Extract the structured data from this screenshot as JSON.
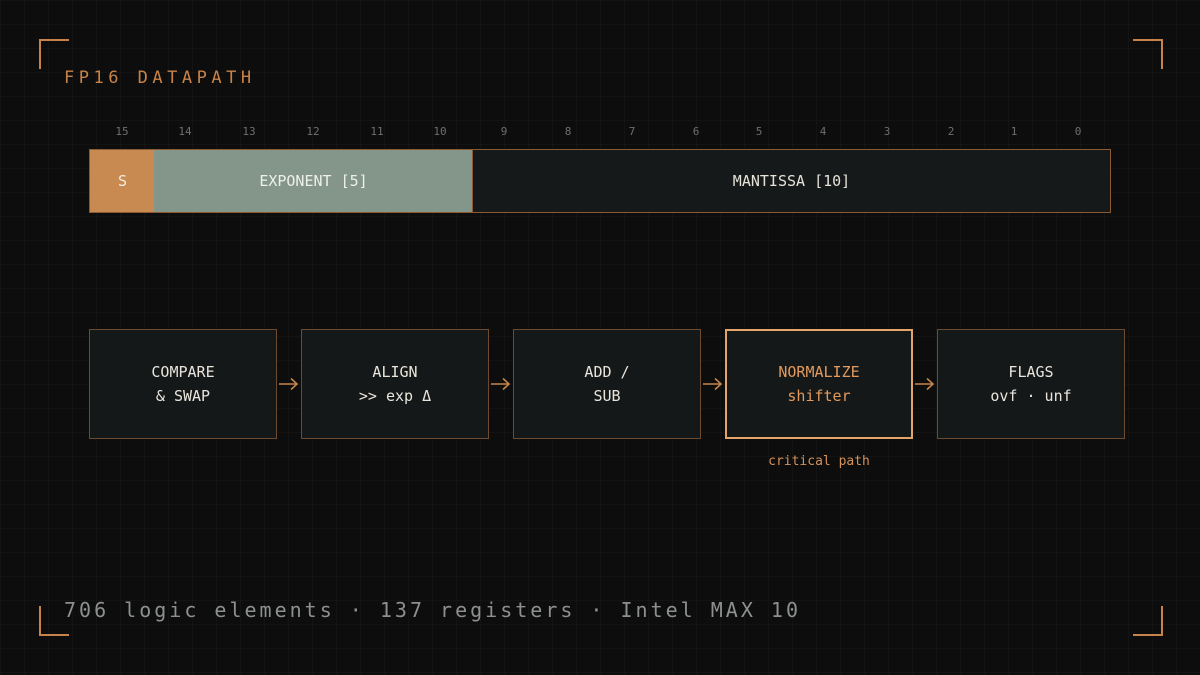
{
  "title": "FP16 DATAPATH",
  "bit_numbers": [
    "15",
    "14",
    "13",
    "12",
    "11",
    "10",
    "9",
    "8",
    "7",
    "6",
    "5",
    "4",
    "3",
    "2",
    "1",
    "0"
  ],
  "fields": {
    "sign": "S",
    "exponent": "EXPONENT [5]",
    "mantissa": "MANTISSA [10]"
  },
  "stages": [
    {
      "line1": "COMPARE",
      "line2": "& SWAP"
    },
    {
      "line1": "ALIGN",
      "line2": ">> exp Δ"
    },
    {
      "line1": "ADD /",
      "line2": "SUB"
    },
    {
      "line1": "NORMALIZE",
      "line2": "shifter"
    },
    {
      "line1": "FLAGS",
      "line2": "ovf · unf"
    }
  ],
  "critical_path_label": "critical path",
  "footer": "706 logic elements · 137 registers · Intel MAX 10",
  "colors": {
    "accent": "#c8834a",
    "sign_field": "#c88a50",
    "exponent_field": "#84968a",
    "highlight_border": "#e3a56a",
    "background": "#0c0d0c"
  }
}
